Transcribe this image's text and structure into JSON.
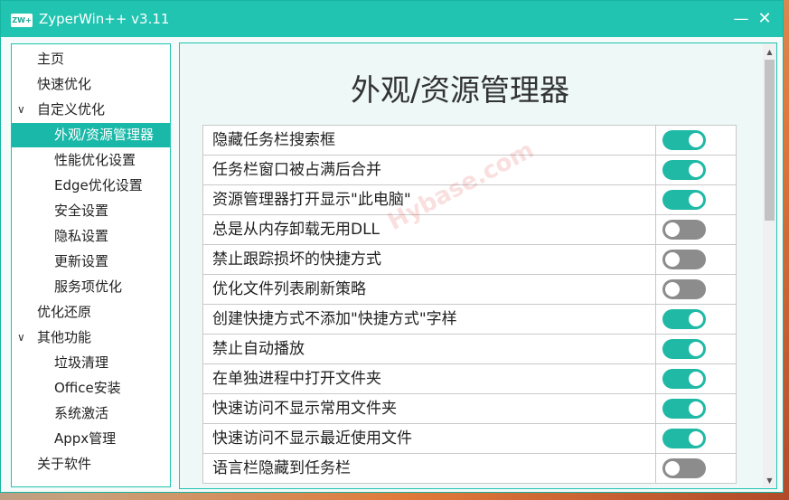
{
  "window": {
    "app_icon_text": "ZW+",
    "title": "ZyperWin++ v3.11",
    "minimize_glyph": "—",
    "close_glyph": "✕"
  },
  "sidebar": {
    "items": [
      {
        "label": "主页",
        "level": 1
      },
      {
        "label": "快速优化",
        "level": 1
      },
      {
        "label": "自定义优化",
        "level": 1,
        "expanded": true
      },
      {
        "label": "外观/资源管理器",
        "level": 2,
        "active": true
      },
      {
        "label": "性能优化设置",
        "level": 2
      },
      {
        "label": "Edge优化设置",
        "level": 2
      },
      {
        "label": "安全设置",
        "level": 2
      },
      {
        "label": "隐私设置",
        "level": 2
      },
      {
        "label": "更新设置",
        "level": 2
      },
      {
        "label": "服务项优化",
        "level": 2
      },
      {
        "label": "优化还原",
        "level": 1
      },
      {
        "label": "其他功能",
        "level": 1,
        "expanded": true
      },
      {
        "label": "垃圾清理",
        "level": 2
      },
      {
        "label": "Office安装",
        "level": 2
      },
      {
        "label": "系统激活",
        "level": 2
      },
      {
        "label": "Appx管理",
        "level": 2
      },
      {
        "label": "关于软件",
        "level": 1
      }
    ]
  },
  "main": {
    "title": "外观/资源管理器",
    "settings": [
      {
        "label": "隐藏任务栏搜索框",
        "on": true
      },
      {
        "label": "任务栏窗口被占满后合并",
        "on": true
      },
      {
        "label": "资源管理器打开显示\"此电脑\"",
        "on": true
      },
      {
        "label": "总是从内存卸载无用DLL",
        "on": false
      },
      {
        "label": "禁止跟踪损坏的快捷方式",
        "on": false
      },
      {
        "label": "优化文件列表刷新策略",
        "on": false
      },
      {
        "label": "创建快捷方式不添加\"快捷方式\"字样",
        "on": true
      },
      {
        "label": "禁止自动播放",
        "on": true
      },
      {
        "label": "在单独进程中打开文件夹",
        "on": true
      },
      {
        "label": "快速访问不显示常用文件夹",
        "on": true
      },
      {
        "label": "快速访问不显示最近使用文件",
        "on": true
      },
      {
        "label": "语言栏隐藏到任务栏",
        "on": false
      }
    ]
  },
  "scrollbar": {
    "up_glyph": "▲",
    "down_glyph": "▼"
  },
  "watermark": "Hybase.com",
  "colors": {
    "accent": "#20c4b0",
    "toggle_on": "#20b9a5",
    "toggle_off": "#8c8c8c"
  }
}
